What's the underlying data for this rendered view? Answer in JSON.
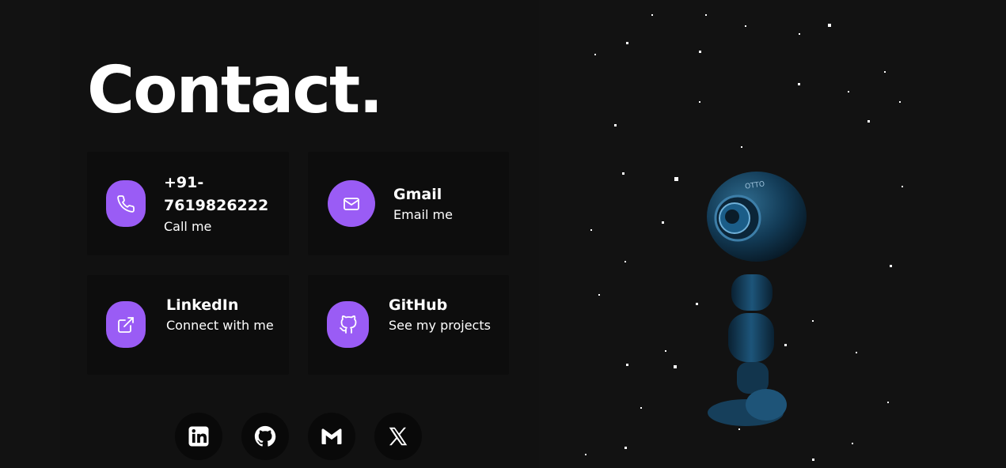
{
  "title": "Contact.",
  "cards": {
    "phone": {
      "title": "+91-7619826222",
      "subtitle": "Call me",
      "icon": "phone-icon"
    },
    "gmail": {
      "title": "Gmail",
      "subtitle": "Email me",
      "icon": "mail-icon"
    },
    "linkedin": {
      "title": "LinkedIn",
      "subtitle": "Connect with me",
      "icon": "external-link-icon"
    },
    "github": {
      "title": "GitHub",
      "subtitle": "See my projects",
      "icon": "github-icon"
    }
  },
  "socials": [
    {
      "name": "LinkedIn",
      "icon": "linkedin-icon"
    },
    {
      "name": "GitHub",
      "icon": "github-icon"
    },
    {
      "name": "Gmail",
      "icon": "gmail-icon"
    },
    {
      "name": "X",
      "icon": "x-icon"
    }
  ],
  "robot": {
    "label": "OTTO"
  },
  "colors": {
    "accent": "#9a5cf5",
    "background": "#121212",
    "card": "#0d0d0d",
    "robot": "#123a55"
  }
}
